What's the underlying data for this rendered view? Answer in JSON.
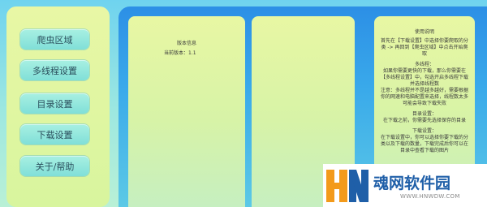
{
  "sidebar": {
    "items": [
      {
        "label": "爬虫区域"
      },
      {
        "label": "多线程设置"
      },
      {
        "label": "目录设置"
      },
      {
        "label": "下载设置"
      },
      {
        "label": "关于/帮助"
      }
    ]
  },
  "version_panel": {
    "title": "版本信息",
    "current_version": "当前版本：1.1"
  },
  "help_panel": {
    "title": "使用说明",
    "paragraphs": [
      "首先在【下载设置】中选择你要爬取的分类 -> 再回到【爬虫区域】中点击开始爬取",
      "多线程：",
      "如果你需要更快的下载，那么你需要在【多线程设置】中，勾选开启多线程下载并选择线程数",
      "注意：多线程并不是越多越好，需要根据你的网速和电脑配置来选择，线程数太多可能会导致下载失败",
      "目录设置：",
      "在下载之前，你需要先选择保存的目录",
      "下载设置：",
      "在下载设置中，你可以选择你要下载的分类以及下载的数量，下载完成后你可以在目录中查看下载的图片"
    ]
  },
  "watermark": {
    "name": "魂网软件园",
    "url": "WWW.HNWDW.COM",
    "logo_letters": "HN",
    "colors": {
      "orange": "#f39a1b",
      "blue": "#1f5fa8"
    }
  }
}
